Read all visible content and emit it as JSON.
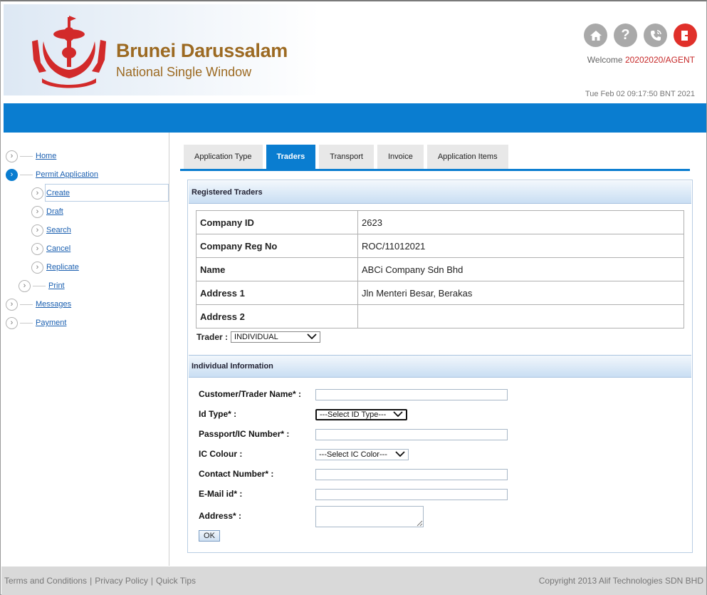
{
  "header": {
    "brand_title": "Brunei Darussalam",
    "brand_subtitle": "National Single Window",
    "icons": [
      "home-icon",
      "help-icon",
      "phone-icon",
      "logout-icon"
    ],
    "welcome_prefix": "Welcome ",
    "welcome_user": "20202020/AGENT",
    "datetime": "Tue Feb 02 09:17:50 BNT 2021"
  },
  "sidebar": {
    "items": [
      {
        "label": "Home"
      },
      {
        "label": "Permit Application"
      },
      {
        "label": "Create"
      },
      {
        "label": "Draft"
      },
      {
        "label": "Search"
      },
      {
        "label": "Cancel"
      },
      {
        "label": "Replicate"
      },
      {
        "label": "Print"
      },
      {
        "label": "Messages"
      },
      {
        "label": "Payment"
      }
    ]
  },
  "tabs": [
    {
      "label": "Application Type"
    },
    {
      "label": "Traders"
    },
    {
      "label": "Transport"
    },
    {
      "label": "Invoice"
    },
    {
      "label": "Application Items"
    }
  ],
  "registered_traders": {
    "title": "Registered Traders",
    "rows": [
      {
        "label": "Company ID",
        "value": "2623"
      },
      {
        "label": "Company Reg No",
        "value": "ROC/11012021"
      },
      {
        "label": "Name",
        "value": "ABCi Company Sdn Bhd"
      },
      {
        "label": "Address 1",
        "value": "Jln Menteri Besar, Berakas"
      },
      {
        "label": "Address 2",
        "value": ""
      }
    ],
    "trader_label": "Trader :",
    "trader_value": "INDIVIDUAL"
  },
  "individual_info": {
    "title": "Individual Information",
    "fields": [
      {
        "label": "Customer/Trader Name* :",
        "value": ""
      },
      {
        "label": "Id Type* :",
        "value": "---Select ID Type---"
      },
      {
        "label": "Passport/IC Number* :",
        "value": ""
      },
      {
        "label": "IC Colour :",
        "value": "---Select IC Color---"
      },
      {
        "label": "Contact Number* :",
        "value": ""
      },
      {
        "label": "E-Mail id* :",
        "value": ""
      },
      {
        "label": "Address* :",
        "value": ""
      }
    ],
    "ok_label": "OK"
  },
  "footer": {
    "links": [
      "Terms and Conditions",
      "Privacy Policy",
      "Quick Tips"
    ],
    "separator": "|",
    "copyright": "Copyright 2013 Alif Technologies SDN BHD"
  },
  "colors": {
    "accent_blue": "#0a7dd0",
    "brand_gold": "#9c6a22",
    "emblem_red": "#d22a2a",
    "logout_red": "#e0302a"
  }
}
